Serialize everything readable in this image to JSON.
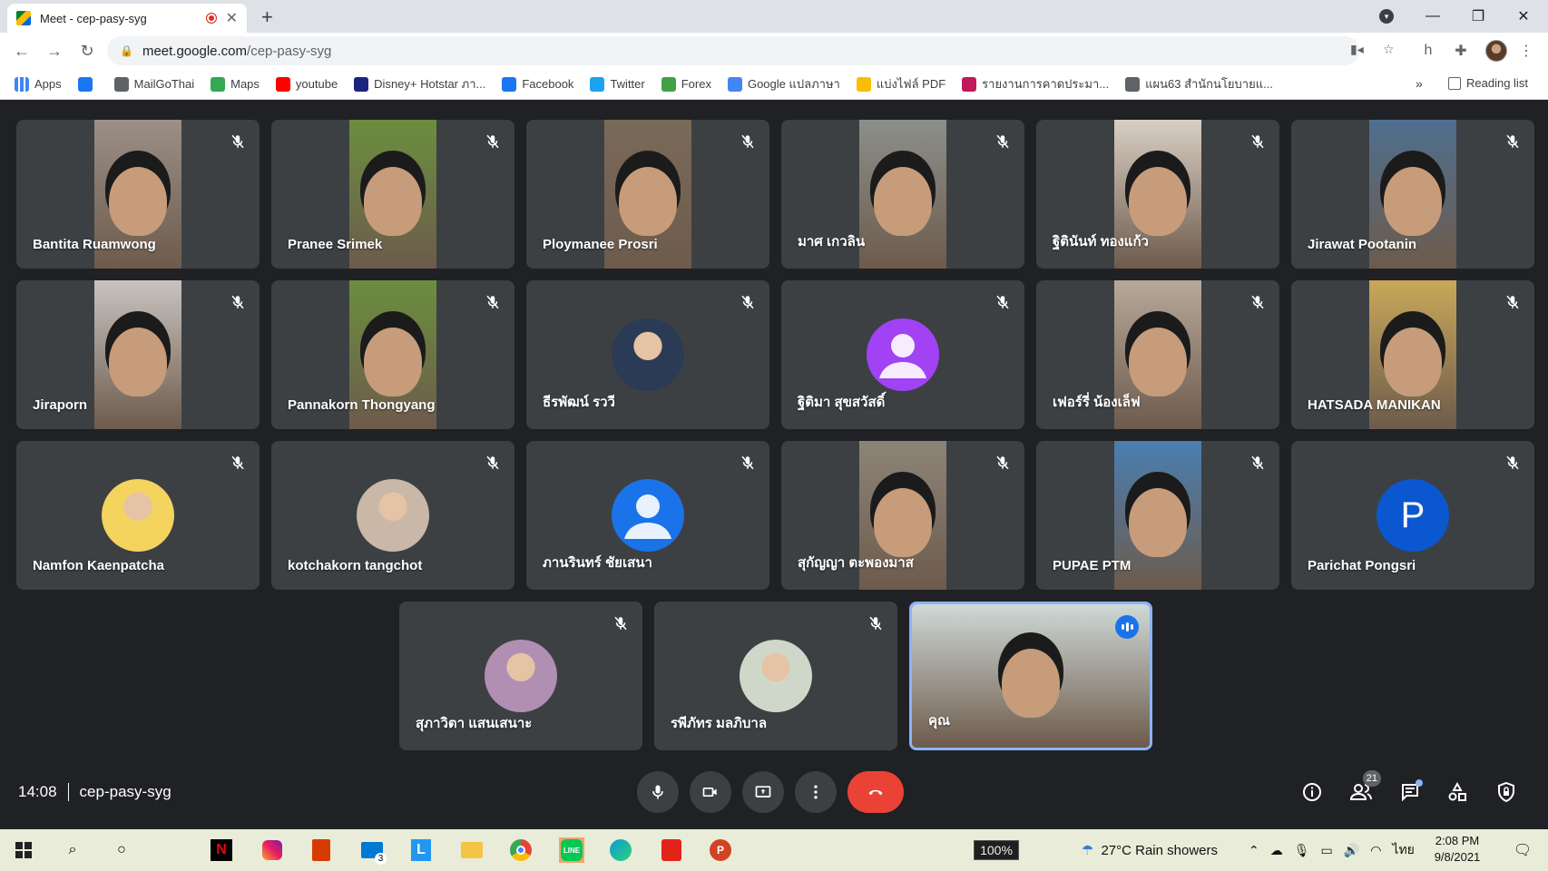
{
  "browser": {
    "tab_title": "Meet - cep-pasy-syg",
    "url_host": "meet.google.com",
    "url_path": "/cep-pasy-syg",
    "bookmarks": [
      {
        "label": "Apps",
        "color": "#4285f4"
      },
      {
        "label": "",
        "color": "#1877f2"
      },
      {
        "label": "MailGoThai",
        "color": "#5f6368"
      },
      {
        "label": "Maps",
        "color": "#34a853"
      },
      {
        "label": "youtube",
        "color": "#ff0000"
      },
      {
        "label": "Disney+ Hotstar ภา...",
        "color": "#1a237e"
      },
      {
        "label": "Facebook",
        "color": "#1877f2"
      },
      {
        "label": "Twitter",
        "color": "#1da1f2"
      },
      {
        "label": "Forex",
        "color": "#43a047"
      },
      {
        "label": "Google แปลภาษา",
        "color": "#4285f4"
      },
      {
        "label": "แบ่งไฟล์ PDF",
        "color": "#fbbc05"
      },
      {
        "label": "รายงานการคาดประมา...",
        "color": "#c2185b"
      },
      {
        "label": "แผน63 สำนักนโยบายแ...",
        "color": "#5f6368"
      }
    ],
    "bookmarks_more": "»",
    "reading_list": "Reading list"
  },
  "participants": [
    {
      "name": "Bantita Ruamwong",
      "kind": "video",
      "tone": "#9b8f87"
    },
    {
      "name": "Pranee Srimek",
      "kind": "video",
      "tone": "#6b8e3e"
    },
    {
      "name": "Ploymanee Prosri",
      "kind": "video",
      "tone": "#7a6a5a"
    },
    {
      "name": "มาศ เกวลิน",
      "kind": "video",
      "tone": "#8c8f8a"
    },
    {
      "name": "ฐิตินันท์ ทองแก้ว",
      "kind": "video",
      "tone": "#d9cfc4"
    },
    {
      "name": "Jirawat Pootanin",
      "kind": "video",
      "tone": "#4e6f8f"
    },
    {
      "name": "Jiraporn",
      "kind": "video",
      "tone": "#c8c3bf"
    },
    {
      "name": "Pannakorn Thongyang",
      "kind": "video",
      "tone": "#6b8e3e"
    },
    {
      "name": "ธีรพัฒน์ รววี",
      "kind": "photo",
      "tone": "#2b3a55"
    },
    {
      "name": "ฐิติมา สุขสวัสดิ์",
      "kind": "initial",
      "tone": "#a142f4",
      "initial": ""
    },
    {
      "name": "เฟอร์รี่ น้องเล็ฟ",
      "kind": "video",
      "tone": "#b7a89a"
    },
    {
      "name": "HATSADA MANIKAN",
      "kind": "video",
      "tone": "#c9a85a"
    },
    {
      "name": "Namfon Kaenpatcha",
      "kind": "photo",
      "tone": "#f4d35e"
    },
    {
      "name": "kotchakorn tangchot",
      "kind": "photo",
      "tone": "#c9b8a8"
    },
    {
      "name": "ภานรินทร์ ชัยเสนา",
      "kind": "initial",
      "tone": "#1a73e8",
      "initial": ""
    },
    {
      "name": "สุกัญญา ตะพองมาส",
      "kind": "video",
      "tone": "#8d8478"
    },
    {
      "name": "PUPAE PTM",
      "kind": "video",
      "tone": "#4a7fb0"
    },
    {
      "name": "Parichat Pongsri",
      "kind": "initial",
      "tone": "#0b57d0",
      "initial": "P"
    },
    {
      "name": "สุภาวิตา แสนเสนาะ",
      "kind": "photo",
      "tone": "#b08fb3"
    },
    {
      "name": "รพีภัทร มลภิบาล",
      "kind": "photo",
      "tone": "#cfd8c8"
    },
    {
      "name": "คุณ",
      "kind": "self",
      "tone": "#cfd9d6"
    }
  ],
  "meeting": {
    "time": "14:08",
    "code": "cep-pasy-syg",
    "participant_count": "21"
  },
  "taskbar": {
    "battery": "100%",
    "weather": "27°C  Rain showers",
    "lang": "ไทย",
    "time": "2:08 PM",
    "date": "9/8/2021",
    "mail_count": "3"
  }
}
